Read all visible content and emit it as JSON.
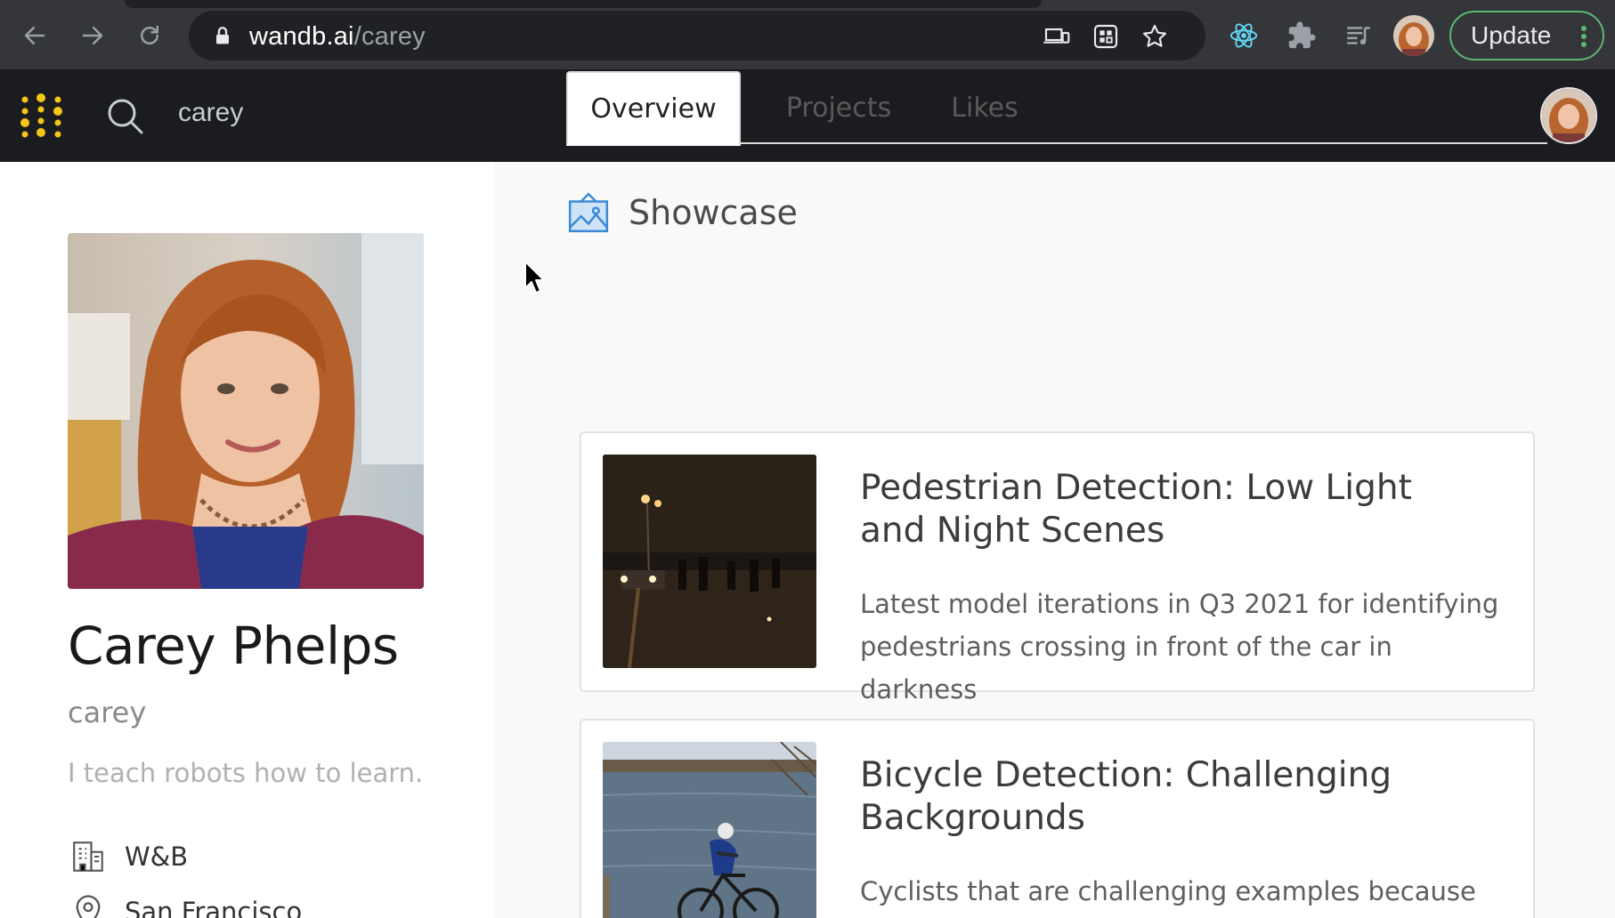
{
  "browser": {
    "url_domain": "wandb.ai",
    "url_path": "/carey",
    "update_label": "Update"
  },
  "header": {
    "search_text": "carey"
  },
  "profile": {
    "name": "Carey Phelps",
    "username": "carey",
    "bio": "I teach robots how to learn.",
    "company": "W&B",
    "location": "San Francisco"
  },
  "tabs": [
    {
      "label": "Overview",
      "active": true
    },
    {
      "label": "Projects",
      "active": false
    },
    {
      "label": "Likes",
      "active": false
    }
  ],
  "showcase": {
    "title": "Showcase",
    "cards": [
      {
        "title": "Pedestrian Detection: Low Light and Night Scenes",
        "description": "Latest model iterations in Q3 2021 for identifying pedestrians crossing in front of the car in darkness"
      },
      {
        "title": "Bicycle Detection: Challenging Backgrounds",
        "description": "Cyclists that are challenging examples because they"
      }
    ]
  },
  "colors": {
    "chrome_bg": "#35363a",
    "app_header_bg": "#1a1c1f",
    "logo_yellow": "#f5c518",
    "update_green": "#5bb974"
  }
}
